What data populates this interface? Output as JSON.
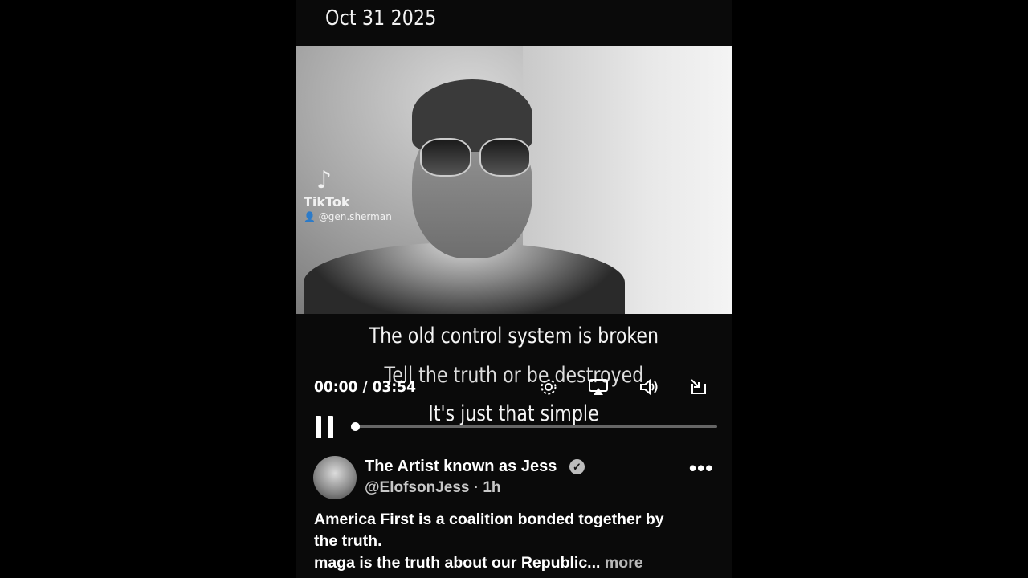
{
  "header": {
    "date": "Oct 31 2025"
  },
  "video": {
    "watermark": {
      "brand": "TikTok",
      "handle": "@gen.sherman"
    },
    "captions": [
      "The old control system is broken",
      "Tell the truth or be destroyed",
      "It's just that simple"
    ],
    "player": {
      "time": "00:00 / 03:54",
      "progress": 0.0,
      "state": "playing",
      "icons": [
        "gear-icon",
        "airplay-icon",
        "volume-icon",
        "exit-fullscreen-icon",
        "pause-icon"
      ]
    }
  },
  "post": {
    "author_name": "The Artist known as Jess",
    "handle_time": "@ElofsonJess · 1h",
    "verified": true,
    "text_line1": "America First is a coalition bonded together by",
    "text_line2": "the truth.",
    "text_line3": "maga is the truth about our Republic...",
    "more_label": "more",
    "menu_label": "•••"
  }
}
